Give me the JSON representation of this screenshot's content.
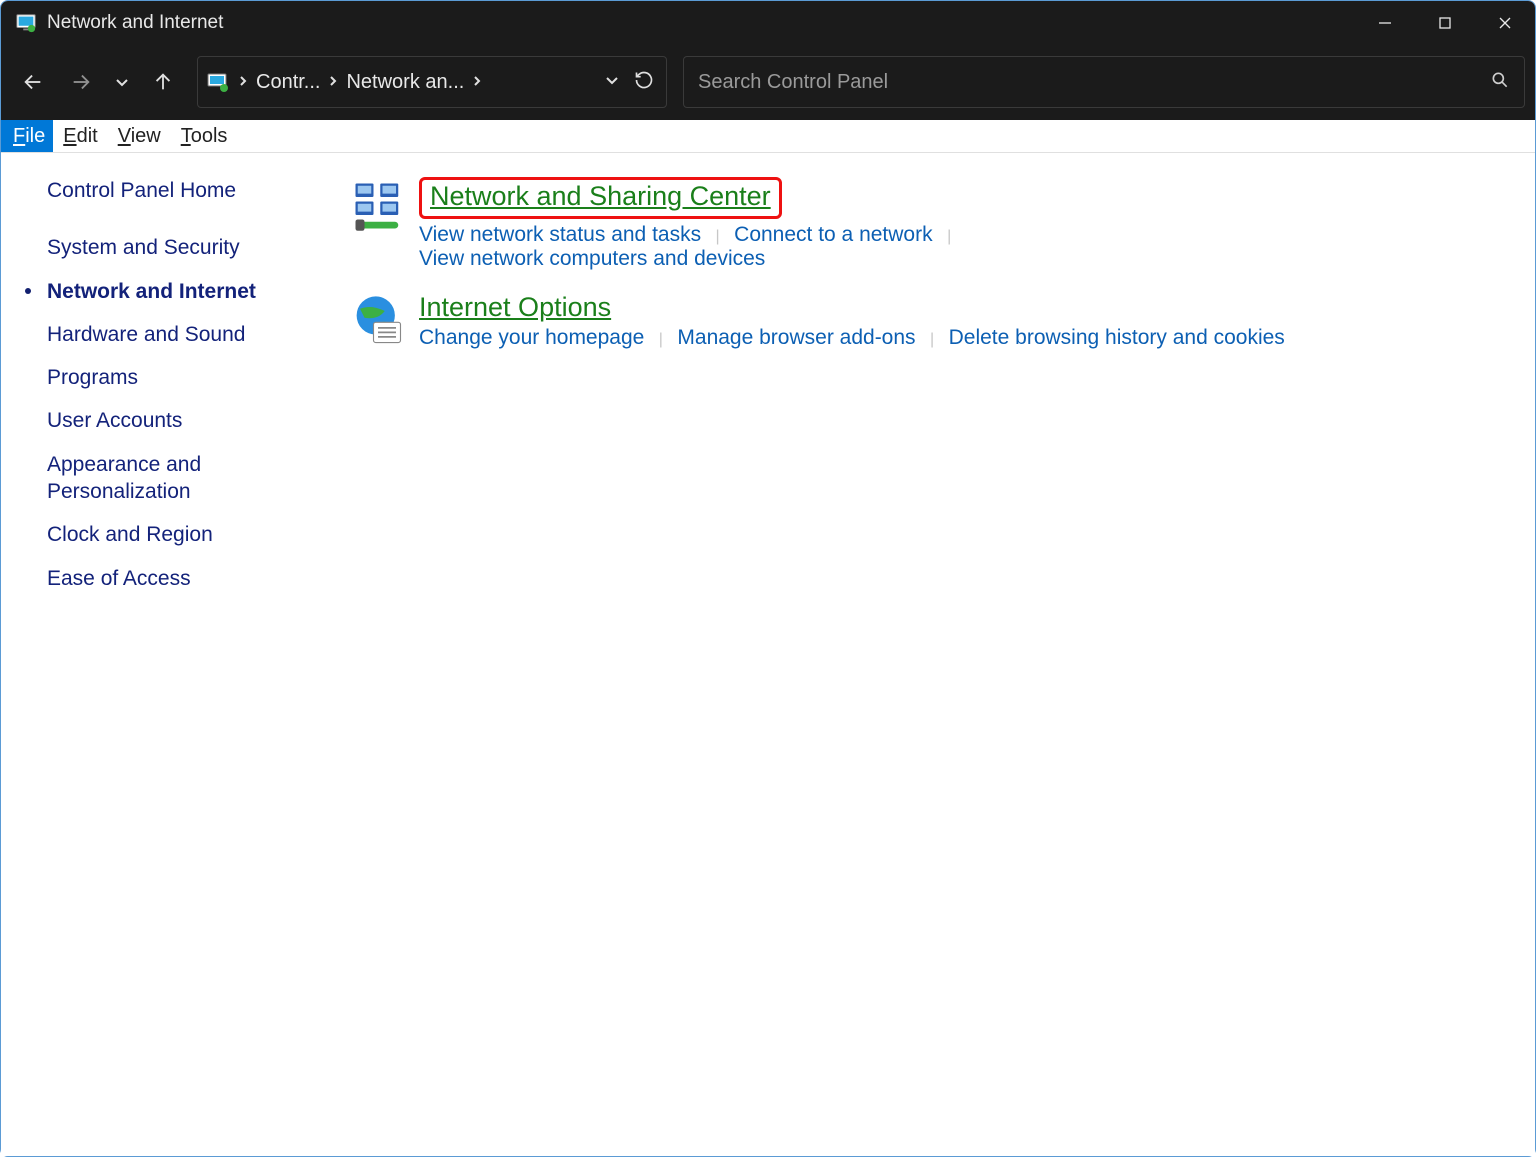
{
  "window": {
    "title": "Network and Internet"
  },
  "address": {
    "seg1": "Contr...",
    "seg2": "Network an..."
  },
  "search": {
    "placeholder": "Search Control Panel"
  },
  "menu": {
    "file": "File",
    "edit": "Edit",
    "view": "View",
    "tools": "Tools"
  },
  "sidebar": {
    "items": [
      {
        "label": "Control Panel Home"
      },
      {
        "label": "System and Security"
      },
      {
        "label": "Network and Internet"
      },
      {
        "label": "Hardware and Sound"
      },
      {
        "label": "Programs"
      },
      {
        "label": "User Accounts"
      },
      {
        "label": "Appearance and Personalization"
      },
      {
        "label": "Clock and Region"
      },
      {
        "label": "Ease of Access"
      }
    ]
  },
  "sections": [
    {
      "title": "Network and Sharing Center",
      "links": [
        "View network status and tasks",
        "Connect to a network",
        "View network computers and devices"
      ]
    },
    {
      "title": "Internet Options",
      "links": [
        "Change your homepage",
        "Manage browser add-ons",
        "Delete browsing history and cookies"
      ]
    }
  ]
}
